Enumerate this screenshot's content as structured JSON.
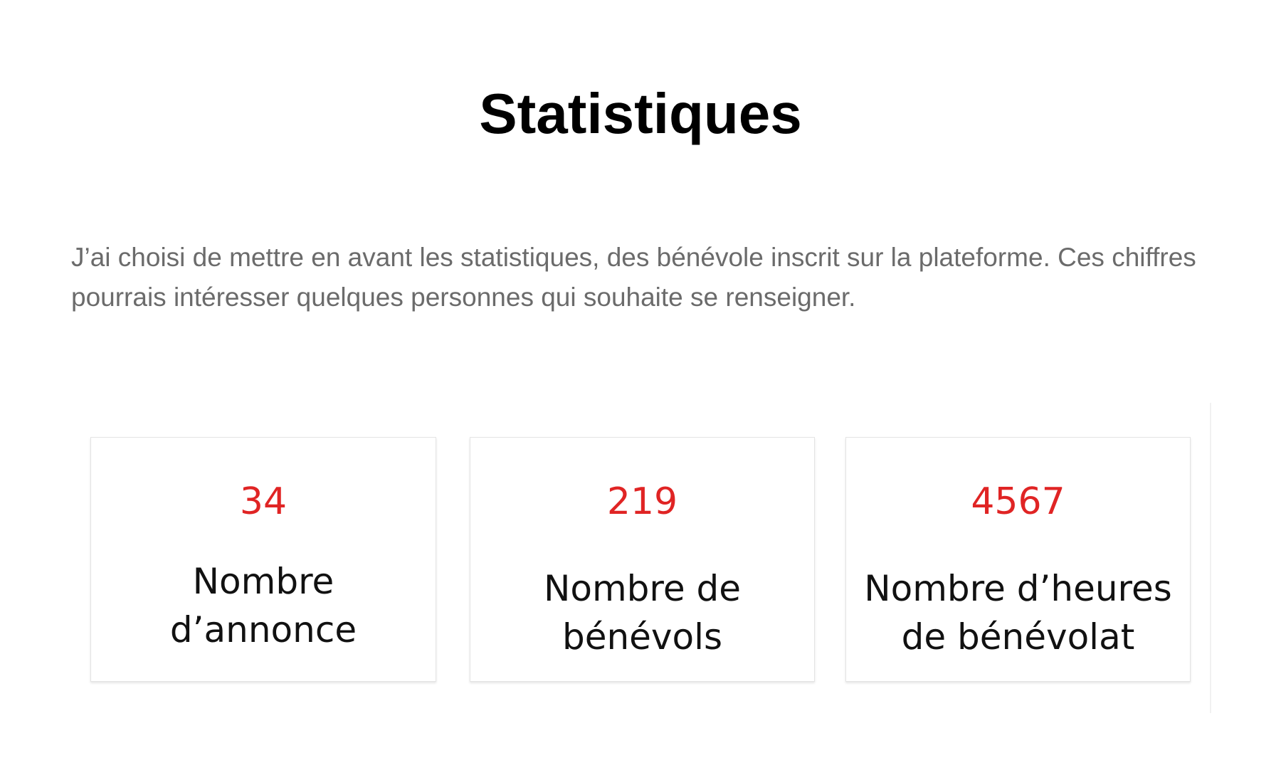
{
  "title": "Statistiques",
  "intro": "J’ai choisi de mettre en avant les statistiques, des bénévole inscrit sur la plateforme. Ces chiffres pourrais intéresser quelques personnes qui souhaite se renseigner.",
  "stats": [
    {
      "value": "34",
      "label_lines": [
        "Nombre",
        "d’annonce"
      ]
    },
    {
      "value": "219",
      "label_lines": [
        "Nombre de",
        "bénévols"
      ]
    },
    {
      "value": "4567",
      "label_lines": [
        "Nombre d’heures",
        "de bénévolat"
      ]
    }
  ],
  "colors": {
    "accent": "#e02424",
    "text": "#111111",
    "muted_text": "#6b6b6b",
    "card_border": "#e4e4e4"
  }
}
